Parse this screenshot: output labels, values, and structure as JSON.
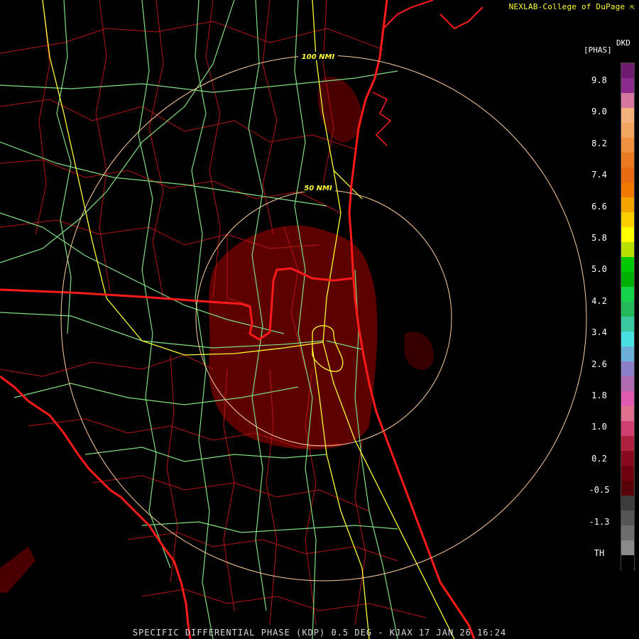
{
  "header": {
    "credit": "NEXLAB-College of DuPage ⇱"
  },
  "rings": {
    "inner_label": "50 NMI",
    "outer_label": "100 NMI"
  },
  "legend": {
    "product_code": "DKD",
    "units": "[PHAS]",
    "ticks": [
      "9.8",
      "9.0",
      "8.2",
      "7.4",
      "6.6",
      "5.8",
      "5.0",
      "4.2",
      "3.4",
      "2.6",
      "1.8",
      "1.0",
      "0.2",
      "-0.5",
      "-1.3",
      "TH"
    ],
    "colors": [
      "#6e1a6e",
      "#8a2a8a",
      "#d5779f",
      "#f5b27a",
      "#f2a760",
      "#ee9040",
      "#ea7a20",
      "#e86a10",
      "#f07a00",
      "#f5a500",
      "#ffd000",
      "#ffff00",
      "#b8e000",
      "#00c800",
      "#00b000",
      "#16d44a",
      "#25b85a",
      "#3ac9a0",
      "#48e0e0",
      "#6ab0d8",
      "#8a7fc8",
      "#b06ab0",
      "#e05ab0",
      "#e07090",
      "#d04070",
      "#b02040",
      "#880a20",
      "#700010",
      "#580008",
      "#3c3c3c",
      "#555555",
      "#6e6e6e",
      "#8a8a8a",
      "#000000"
    ]
  },
  "map": {
    "colors": {
      "state_border": "#ff1a1a",
      "county_border": "#b81414",
      "highway_yellow": "#ffff33",
      "highway_green": "#7fdf7f",
      "range_ring": "#ffcc99",
      "echo": "#6e0000"
    }
  },
  "footer": {
    "caption": "SPECIFIC DIFFERENTIAL PHASE (KDP) 0.5 DEG - KJAX 17 JAN 26 16:24"
  }
}
